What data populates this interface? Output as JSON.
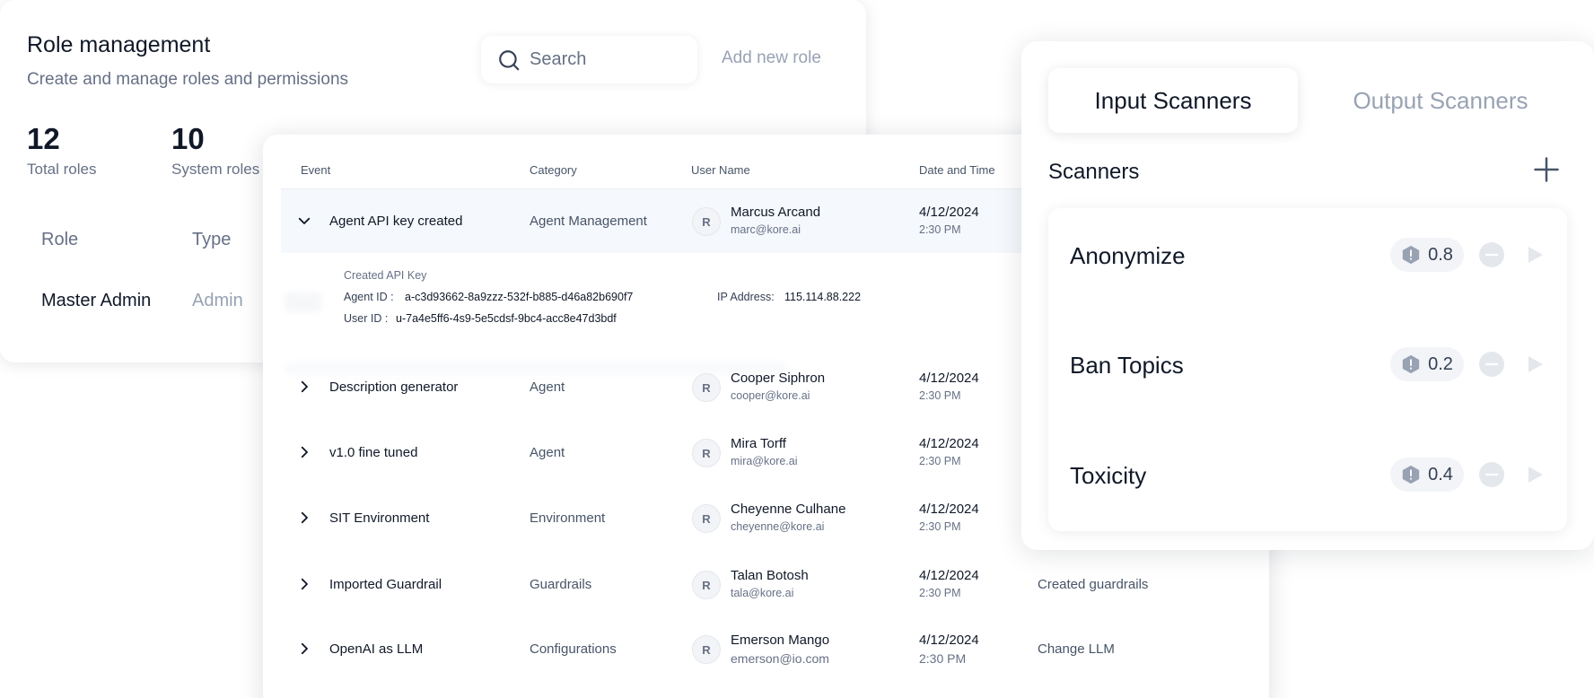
{
  "role_management": {
    "title": "Role management",
    "subtitle": "Create and manage roles and permissions",
    "search_placeholder": "Search",
    "add_button": "Add new role",
    "stats": [
      {
        "value": "12",
        "label": "Total roles"
      },
      {
        "value": "10",
        "label": "System roles"
      }
    ],
    "columns": [
      "Role",
      "Type"
    ],
    "rows": [
      {
        "role": "Master Admin",
        "type": "Admin"
      }
    ]
  },
  "event_log": {
    "columns": [
      "Event",
      "Category",
      "User Name",
      "Date and Time"
    ],
    "expanded_details": {
      "caption": "Created API Key",
      "agent_id_label": "Agent ID :",
      "agent_id": "a-c3d93662-8a9zzz-532f-b885-d46a82b690f7",
      "ip_label": "IP Address:",
      "ip": "115.114.88.222",
      "user_id_label": "User ID :",
      "user_id": "u-7a4e5ff6-4s9-5e5cdsf-9bc4-acc8e47d3bdf"
    },
    "rows": [
      {
        "event": "Agent API key created",
        "category": "Agent Management",
        "initial": "R",
        "user": "Marcus Arcand",
        "email": "marc@kore.ai",
        "date": "4/12/2024",
        "time": "2:30 PM",
        "action": ""
      },
      {
        "event": "Description generator",
        "category": "Agent",
        "initial": "R",
        "user": "Cooper Siphron",
        "email": "cooper@kore.ai",
        "date": "4/12/2024",
        "time": "2:30 PM",
        "action": ""
      },
      {
        "event": "v1.0 fine tuned",
        "category": "Agent",
        "initial": "R",
        "user": "Mira Torff",
        "email": "mira@kore.ai",
        "date": "4/12/2024",
        "time": "2:30 PM",
        "action": ""
      },
      {
        "event": "SIT Environment",
        "category": "Environment",
        "initial": "R",
        "user": "Cheyenne Culhane",
        "email": "cheyenne@kore.ai",
        "date": "4/12/2024",
        "time": "2:30 PM",
        "action": ""
      },
      {
        "event": "Imported Guardrail",
        "category": "Guardrails",
        "initial": "R",
        "user": "Talan Botosh",
        "email": "tala@kore.ai",
        "date": "4/12/2024",
        "time": "2:30 PM",
        "action": "Created guardrails"
      },
      {
        "event": "OpenAI as LLM",
        "category": "Configurations",
        "initial": "R",
        "user": "Emerson Mango",
        "email": "emerson@io.com",
        "date": "4/12/2024",
        "time": "2:30 PM",
        "action": "Change LLM"
      }
    ]
  },
  "scanners": {
    "tabs": [
      "Input Scanners",
      "Output Scanners"
    ],
    "active_tab": "Input Scanners",
    "heading": "Scanners",
    "items": [
      {
        "name": "Anonymize",
        "score": "0.8"
      },
      {
        "name": "Ban Topics",
        "score": "0.2"
      },
      {
        "name": "Toxicity",
        "score": "0.4"
      }
    ]
  }
}
